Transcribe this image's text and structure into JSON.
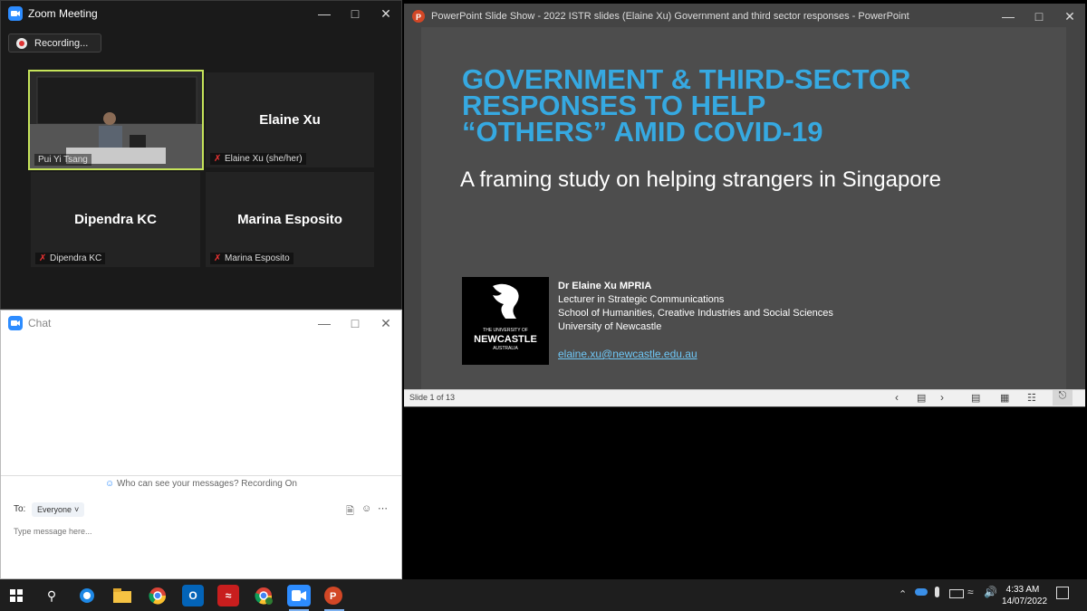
{
  "zoom": {
    "title": "Zoom Meeting",
    "recording": "Recording...",
    "tiles": [
      {
        "big": "",
        "label": "Pui Yi Tsang"
      },
      {
        "big": "Elaine Xu",
        "label": "Elaine Xu (she/her)"
      },
      {
        "big": "Dipendra KC",
        "label": "Dipendra KC"
      },
      {
        "big": "Marina Esposito",
        "label": "Marina Esposito"
      }
    ]
  },
  "chat": {
    "title": "Chat",
    "notice": "Who can see your messages? Recording On",
    "to_label": "To:",
    "recipient": "Everyone",
    "placeholder": "Type message here..."
  },
  "ppt": {
    "title": "PowerPoint Slide Show  -  2022 ISTR slides (Elaine Xu) Government and third sector responses  -  PowerPoint",
    "slide_counter": "Slide 1 of 13",
    "slide": {
      "headline": [
        "GOVERNMENT & THIRD-SECTOR",
        "RESPONSES TO HELP",
        "“OTHERS” AMID COVID-19"
      ],
      "subtitle": "A framing study on helping strangers in Singapore",
      "author": "Dr Elaine Xu MPRIA",
      "role": "Lecturer in Strategic Communications",
      "school": "School of Humanities, Creative Industries and Social Sciences",
      "university": "University of Newcastle",
      "email": "elaine.xu@newcastle.edu.au",
      "logo_small": "THE UNIVERSITY OF",
      "logo_big": "NEWCASTLE",
      "logo_country": "AUSTRALIA"
    },
    "colors": {
      "headline": "#36a9e1",
      "slide_bg": "#4d4d4d"
    }
  },
  "taskbar": {
    "time": "4:33 AM",
    "date": "14/07/2022",
    "apps": [
      "windows-icon",
      "search-icon",
      "cortana-icon",
      "file-explorer-icon",
      "chrome-icon",
      "outlook-icon",
      "acrobat-icon",
      "chrome-profile-icon",
      "zoom-icon",
      "powerpoint-icon"
    ]
  }
}
